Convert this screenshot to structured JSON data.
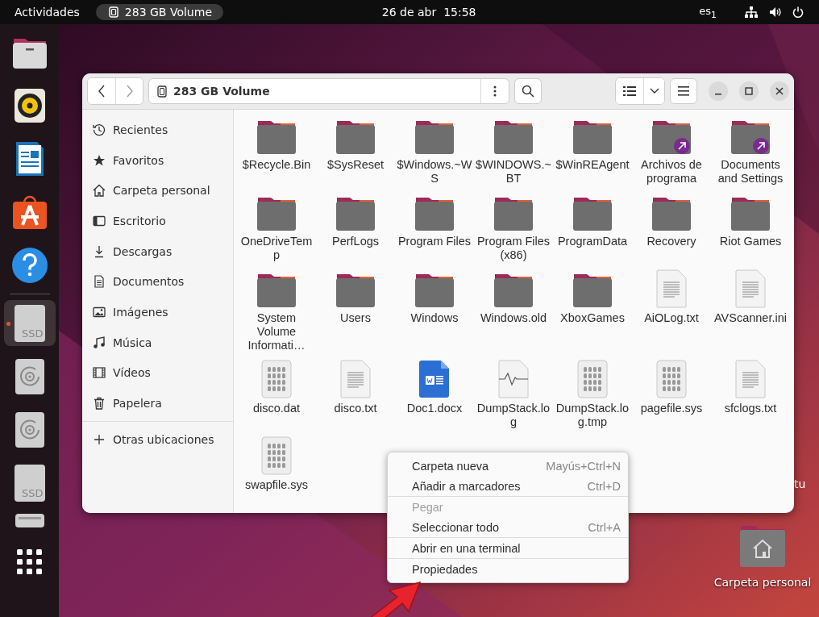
{
  "top_bar": {
    "activities": "Actividades",
    "app": "283 GB Volume",
    "clock": "26 de abr  15:58",
    "keyboard": "es$_{1}$"
  },
  "dock": [
    {
      "kind": "files"
    },
    {
      "kind": "music"
    },
    {
      "kind": "writer"
    },
    {
      "kind": "store"
    },
    {
      "kind": "help"
    },
    {
      "kind": "separator"
    },
    {
      "kind": "ssd",
      "label": "SSD",
      "running": true
    },
    {
      "kind": "disc"
    },
    {
      "kind": "disc"
    },
    {
      "kind": "ssd",
      "label": "SSD"
    },
    {
      "kind": "drive"
    }
  ],
  "window": {
    "location": "283 GB Volume",
    "sidebar": [
      {
        "kind": "recent",
        "label": "Recientes",
        "selected": false
      },
      {
        "kind": "starred",
        "label": "Favoritos",
        "selected": false
      },
      {
        "kind": "home",
        "label": "Carpeta personal",
        "selected": false
      },
      {
        "kind": "desktop",
        "label": "Escritorio",
        "selected": false
      },
      {
        "kind": "downloads",
        "label": "Descargas",
        "selected": false
      },
      {
        "kind": "documents",
        "label": "Documentos",
        "selected": false
      },
      {
        "kind": "pictures",
        "label": "Imágenes",
        "selected": false
      },
      {
        "kind": "music",
        "label": "Música",
        "selected": false
      },
      {
        "kind": "videos",
        "label": "Vídeos",
        "selected": false
      },
      {
        "kind": "trash",
        "label": "Papelera",
        "selected": false
      },
      {
        "kind": "other",
        "label": "Otras ubicaciones",
        "selected": false
      }
    ],
    "files": [
      {
        "kind": "folder",
        "name": "$Recycle.Bin"
      },
      {
        "kind": "folder",
        "name": "$SysReset"
      },
      {
        "kind": "folder",
        "name": "$Windows.~WS"
      },
      {
        "kind": "folder",
        "name": "$WINDOWS.~BT"
      },
      {
        "kind": "folder",
        "name": "$WinREAgent"
      },
      {
        "kind": "link-folder",
        "name": "Archivos de programa"
      },
      {
        "kind": "link-folder",
        "name": "Documents and Settings"
      },
      {
        "kind": "folder",
        "name": "OneDriveTemp"
      },
      {
        "kind": "folder",
        "name": "PerfLogs"
      },
      {
        "kind": "folder",
        "name": "Program Files"
      },
      {
        "kind": "folder",
        "name": "Program Files (x86)"
      },
      {
        "kind": "folder",
        "name": "ProgramData"
      },
      {
        "kind": "folder",
        "name": "Recovery"
      },
      {
        "kind": "folder",
        "name": "Riot Games"
      },
      {
        "kind": "folder",
        "name": "System Volume Informati…"
      },
      {
        "kind": "folder",
        "name": "Users"
      },
      {
        "kind": "folder",
        "name": "Windows"
      },
      {
        "kind": "folder",
        "name": "Windows.old"
      },
      {
        "kind": "folder",
        "name": "XboxGames"
      },
      {
        "kind": "text",
        "name": "AiOLog.txt"
      },
      {
        "kind": "text",
        "name": "AVScanner.ini"
      },
      {
        "kind": "binary",
        "name": "disco.dat"
      },
      {
        "kind": "text",
        "name": "disco.txt"
      },
      {
        "kind": "word",
        "name": "Doc1.docx"
      },
      {
        "kind": "log",
        "name": "DumpStack.log"
      },
      {
        "kind": "binary",
        "name": "DumpStack.log.tmp"
      },
      {
        "kind": "binary",
        "name": "pagefile.sys"
      },
      {
        "kind": "text",
        "name": "sfclogs.txt"
      },
      {
        "kind": "binary",
        "name": "swapfile.sys"
      }
    ]
  },
  "context_menu": [
    [
      {
        "label": "Carpeta nueva",
        "shortcut": "Mayús+Ctrl+N",
        "disabled": false
      },
      {
        "label": "Añadir a marcadores",
        "shortcut": "Ctrl+D",
        "disabled": false
      }
    ],
    [
      {
        "label": "Pegar",
        "disabled": true
      },
      {
        "label": "Seleccionar todo",
        "shortcut": "Ctrl+A",
        "disabled": false
      }
    ],
    [
      {
        "label": "Abrir en una terminal",
        "disabled": false
      }
    ],
    [
      {
        "label": "Propiedades",
        "disabled": false
      }
    ]
  ],
  "desktop": {
    "hidden_label": "tu",
    "home_icon": "Carpeta personal"
  }
}
